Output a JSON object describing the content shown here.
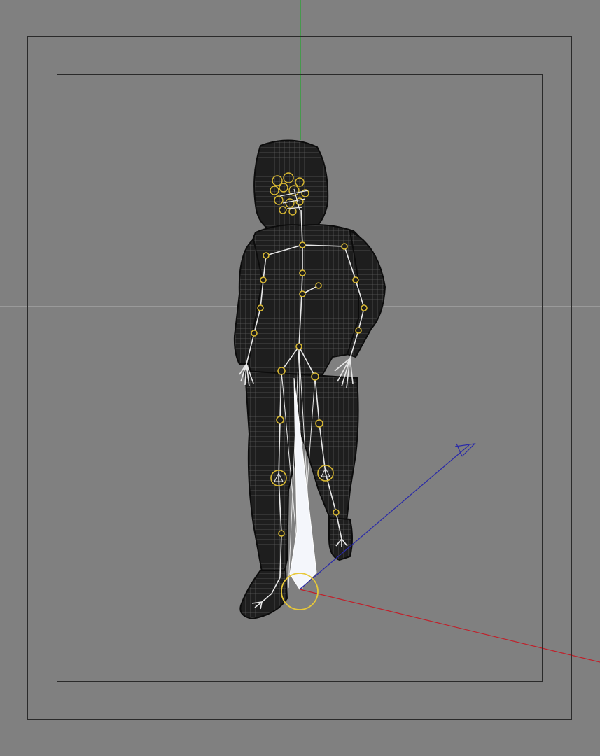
{
  "viewport": {
    "background": "#808080",
    "frame_color": "#2a2a2a",
    "mesh_color": "#1e1e1e",
    "wire_color": "#5a5a5a",
    "bone_color": "#e8e8e8",
    "joint_color": "#d8b832",
    "axis_colors": {
      "x": "#c0202a",
      "y": "#1faa2c",
      "z": "#2a2aa8"
    },
    "icons": [
      "character-mesh",
      "skeleton-rig",
      "axis-gizmo",
      "root-controller"
    ]
  }
}
